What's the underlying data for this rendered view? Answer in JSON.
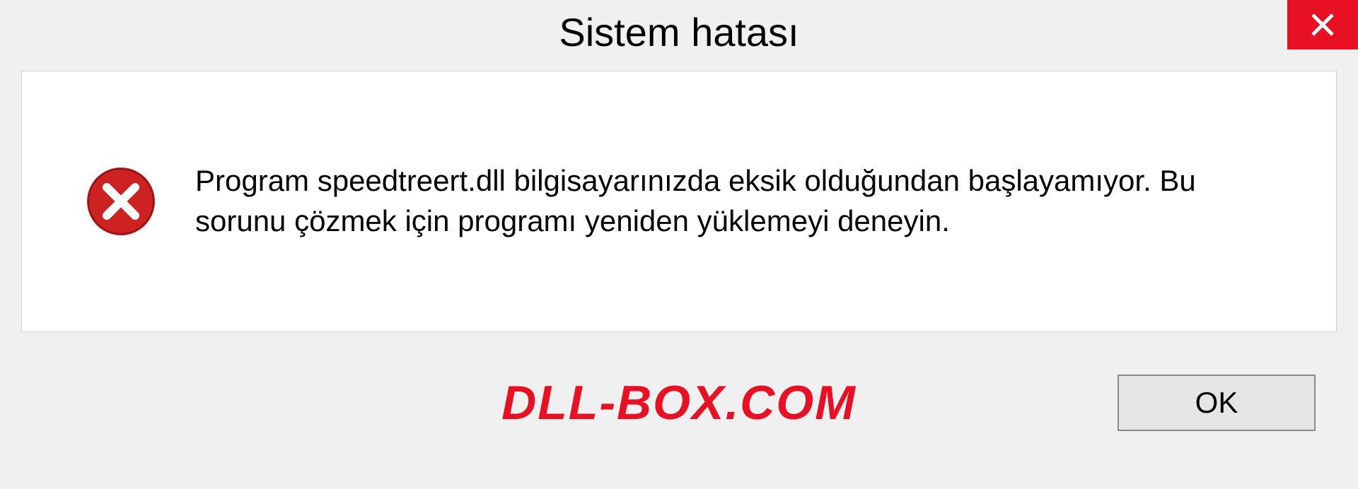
{
  "dialog": {
    "title": "Sistem hatası",
    "message": "Program speedtreert.dll bilgisayarınızda eksik olduğundan başlayamıyor. Bu sorunu çözmek için programı yeniden yüklemeyi deneyin.",
    "ok_label": "OK"
  },
  "watermark": "DLL-BOX.COM"
}
